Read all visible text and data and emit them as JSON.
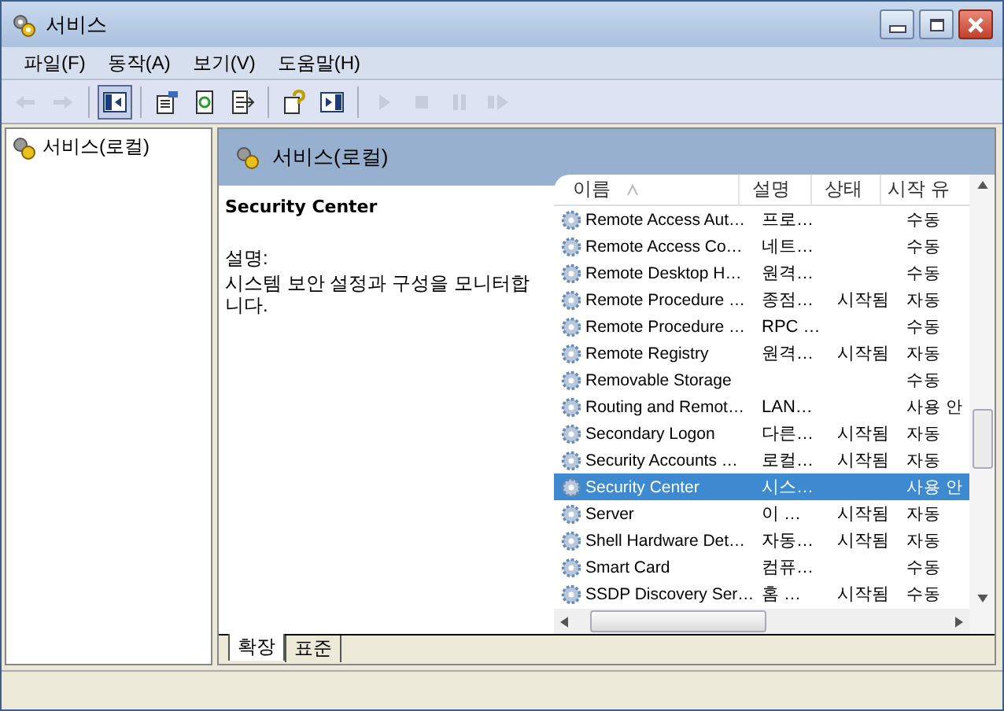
{
  "window": {
    "title": "서비스"
  },
  "menu": [
    "파일(F)",
    "동작(A)",
    "보기(V)",
    "도움말(H)"
  ],
  "toolbar": [
    {
      "kind": "back",
      "disabled": true,
      "pressed": false
    },
    {
      "kind": "forward",
      "disabled": true,
      "pressed": false
    },
    {
      "kind": "tree",
      "disabled": false,
      "pressed": true
    },
    {
      "kind": "properties",
      "disabled": false,
      "pressed": false
    },
    {
      "kind": "refresh",
      "disabled": false,
      "pressed": false
    },
    {
      "kind": "export",
      "disabled": false,
      "pressed": false
    },
    {
      "kind": "help",
      "disabled": false,
      "pressed": false
    },
    {
      "kind": "pane",
      "disabled": false,
      "pressed": false
    },
    {
      "kind": "play",
      "disabled": true,
      "pressed": false
    },
    {
      "kind": "stop",
      "disabled": true,
      "pressed": false
    },
    {
      "kind": "pause",
      "disabled": true,
      "pressed": false
    },
    {
      "kind": "restart",
      "disabled": true,
      "pressed": false
    }
  ],
  "tree": {
    "items": [
      {
        "label": "서비스(로컬)",
        "selected": false
      }
    ]
  },
  "pane_header": "서비스(로컬)",
  "details": {
    "title": "Security Center",
    "label": "설명:",
    "text": "시스템 보안 설정과 구성을 모니터합니다."
  },
  "table": {
    "columns": [
      "이름",
      "설명",
      "상태",
      "시작 유"
    ],
    "rows": [
      {
        "name": "Remote Access Aut…",
        "description": "프로…",
        "status": "",
        "startup": "수동",
        "selected": false
      },
      {
        "name": "Remote Access Co…",
        "description": "네트…",
        "status": "",
        "startup": "수동",
        "selected": false
      },
      {
        "name": "Remote Desktop H…",
        "description": "원격…",
        "status": "",
        "startup": "수동",
        "selected": false
      },
      {
        "name": "Remote Procedure …",
        "description": "종점…",
        "status": "시작됨",
        "startup": "자동",
        "selected": false
      },
      {
        "name": "Remote Procedure …",
        "description": "RPC …",
        "status": "",
        "startup": "수동",
        "selected": false
      },
      {
        "name": "Remote Registry",
        "description": "원격…",
        "status": "시작됨",
        "startup": "자동",
        "selected": false
      },
      {
        "name": "Removable Storage",
        "description": "",
        "status": "",
        "startup": "수동",
        "selected": false
      },
      {
        "name": "Routing and Remot…",
        "description": "LAN…",
        "status": "",
        "startup": "사용 안",
        "selected": false
      },
      {
        "name": "Secondary Logon",
        "description": "다른…",
        "status": "시작됨",
        "startup": "자동",
        "selected": false
      },
      {
        "name": "Security Accounts …",
        "description": "로컬…",
        "status": "시작됨",
        "startup": "자동",
        "selected": false
      },
      {
        "name": "Security Center",
        "description": "시스…",
        "status": "",
        "startup": "사용 안",
        "selected": true
      },
      {
        "name": "Server",
        "description": "이 …",
        "status": "시작됨",
        "startup": "자동",
        "selected": false
      },
      {
        "name": "Shell Hardware Det…",
        "description": "자동…",
        "status": "시작됨",
        "startup": "자동",
        "selected": false
      },
      {
        "name": "Smart Card",
        "description": "컴퓨…",
        "status": "",
        "startup": "수동",
        "selected": false
      },
      {
        "name": "SSDP Discovery Ser…",
        "description": "홈 …",
        "status": "시작됨",
        "startup": "수동",
        "selected": false
      }
    ]
  },
  "tabs": [
    {
      "label": "확장",
      "selected": true
    },
    {
      "label": "표준",
      "selected": false
    }
  ]
}
